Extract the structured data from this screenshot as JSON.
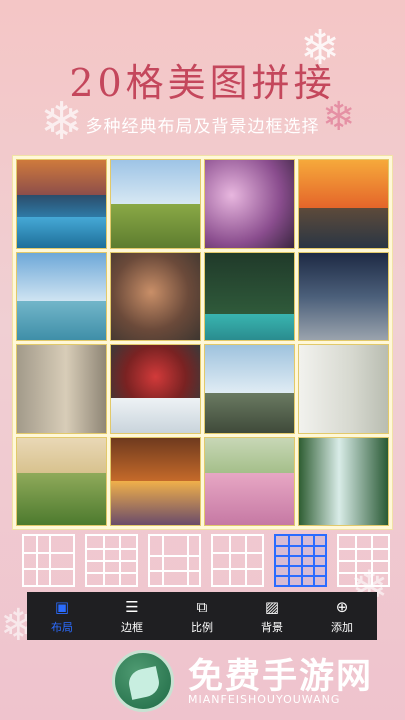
{
  "header": {
    "title": "20格美图拼接",
    "subtitle": "多种经典布局及背景边框选择"
  },
  "collage": {
    "photo_count": 20,
    "tiles": [
      {
        "desc": "mountain lake"
      },
      {
        "desc": "meadow with van"
      },
      {
        "desc": "pink blossoms"
      },
      {
        "desc": "sunset over water"
      },
      {
        "desc": "blue sky lake"
      },
      {
        "desc": "woman with camera"
      },
      {
        "desc": "pine forest"
      },
      {
        "desc": "person on street"
      },
      {
        "desc": "woman on stairs"
      },
      {
        "desc": "red dolls in snow"
      },
      {
        "desc": "castle"
      },
      {
        "desc": "woman with flowers"
      },
      {
        "desc": "rolling hills"
      },
      {
        "desc": "city sunset"
      },
      {
        "desc": "woman in field"
      },
      {
        "desc": "waterfall"
      }
    ]
  },
  "patterns": {
    "count": 6,
    "selected_index": 4
  },
  "toolbar": {
    "items": [
      {
        "label": "布局",
        "icon": "layout-icon"
      },
      {
        "label": "边框",
        "icon": "border-icon"
      },
      {
        "label": "比例",
        "icon": "ratio-icon"
      },
      {
        "label": "背景",
        "icon": "background-icon"
      },
      {
        "label": "添加",
        "icon": "add-icon"
      }
    ],
    "active_index": 0,
    "accent": "#2b6cff"
  },
  "footer": {
    "name": "免费手游网",
    "url": "MIANFEISHOUYOUWANG"
  },
  "colors": {
    "title": "#c4475c",
    "bg": "#f4c6c6",
    "toolbar_bg": "#1f1f22"
  }
}
